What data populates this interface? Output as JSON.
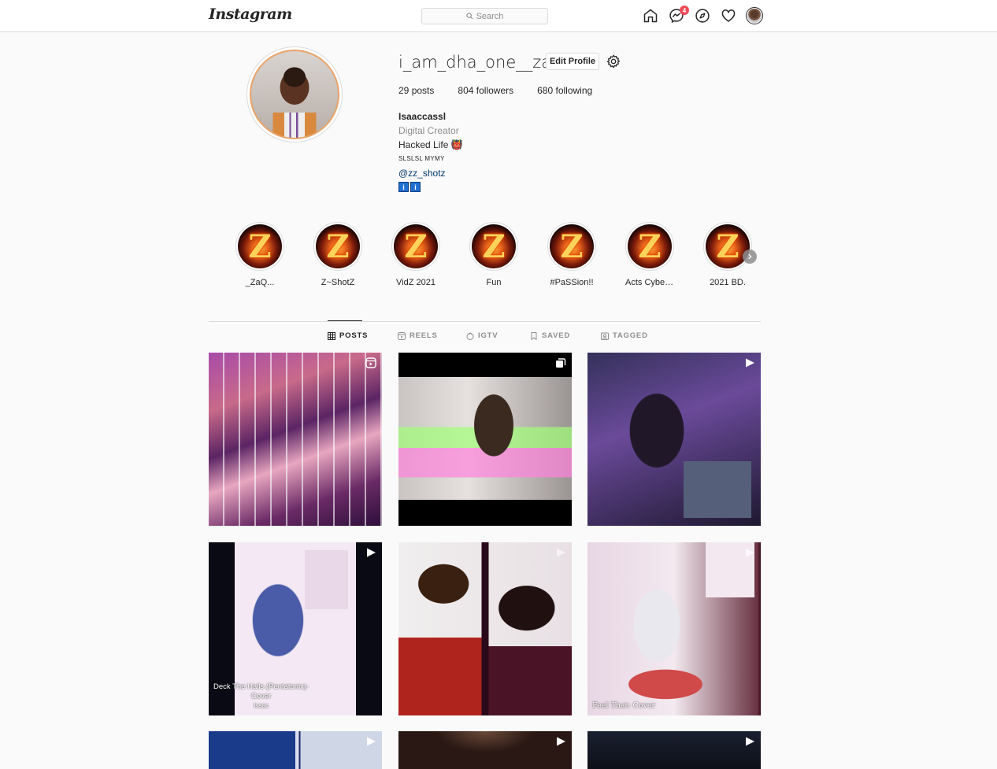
{
  "header": {
    "logo": "Instagram",
    "search_placeholder": "Search",
    "notifications_count": "4"
  },
  "profile": {
    "username": "i_am_dha_one__zac",
    "edit_button": "Edit Profile",
    "stats": {
      "posts": "29",
      "posts_label": "posts",
      "followers": "804",
      "followers_label": "followers",
      "following": "680",
      "following_label": "following"
    },
    "bio": {
      "full_name": "Isaaccassl",
      "category": "Digital Creator",
      "line1": "Hacked Life 👹",
      "line2": "SLSLSL MYMY",
      "link": "@zz_shotz",
      "badges": [
        "i",
        "i"
      ]
    }
  },
  "highlights": [
    {
      "label": "_ZaQ...",
      "glyph": "Z"
    },
    {
      "label": "Z~ShotZ",
      "glyph": "Z"
    },
    {
      "label": "VidZ 2021",
      "glyph": "Z"
    },
    {
      "label": "Fun",
      "glyph": "Z"
    },
    {
      "label": "#PaSSion!!",
      "glyph": "Z"
    },
    {
      "label": "Acts Cyberj...",
      "glyph": "Z"
    },
    {
      "label": "2021 BD.",
      "glyph": "Z"
    }
  ],
  "tabs": [
    {
      "label": "POSTS",
      "icon": "grid-icon",
      "active": true
    },
    {
      "label": "REELS",
      "icon": "reels-icon",
      "active": false
    },
    {
      "label": "IGTV",
      "icon": "igtv-icon",
      "active": false
    },
    {
      "label": "SAVED",
      "icon": "bookmark-icon",
      "active": false
    },
    {
      "label": "TAGGED",
      "icon": "tagged-icon",
      "active": false
    }
  ],
  "posts": [
    {
      "type": "reel",
      "caption": ""
    },
    {
      "type": "carousel",
      "caption": ""
    },
    {
      "type": "video",
      "caption": ""
    },
    {
      "type": "video",
      "caption_line1": "Deck The Halls (Pentatonix)-",
      "caption_line2": "Cover",
      "caption_line3": "Isaac"
    },
    {
      "type": "video",
      "caption": ""
    },
    {
      "type": "video",
      "caption": "Feel That: Cover"
    },
    {
      "type": "video",
      "caption": ""
    },
    {
      "type": "video",
      "caption": ""
    },
    {
      "type": "video",
      "caption": ""
    }
  ]
}
